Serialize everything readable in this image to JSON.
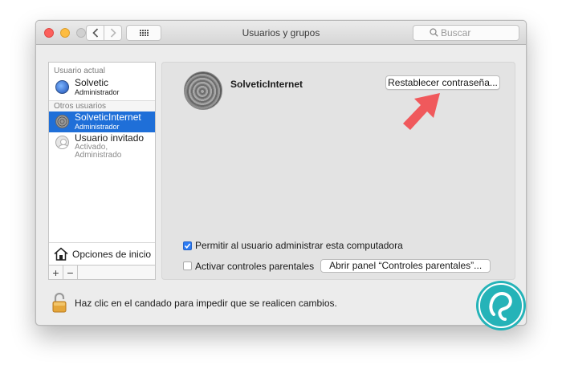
{
  "window": {
    "title": "Usuarios y grupos",
    "search_placeholder": "Buscar"
  },
  "sidebar": {
    "current_header": "Usuario actual",
    "other_header": "Otros usuarios",
    "users": [
      {
        "name": "Solvetic",
        "role": "Administrador",
        "icon": "globe-avatar"
      },
      {
        "name": "SolveticInternet",
        "role": "Administrador",
        "icon": "swirl-avatar",
        "selected": true
      },
      {
        "name": "Usuario invitado",
        "role": "Activado, Administrado",
        "icon": "guest-avatar"
      }
    ],
    "login_options": "Opciones de inicio",
    "add_label": "+",
    "remove_label": "−"
  },
  "content": {
    "username": "SolveticInternet",
    "reset_button": "Restablecer contraseña...",
    "admin_checkbox": {
      "label": "Permitir al usuario administrar esta computadora",
      "checked": true
    },
    "parental_checkbox": {
      "label": "Activar controles parentales",
      "checked": false
    },
    "parental_button": "Abrir panel “Controles parentales”..."
  },
  "lock_text": "Haz clic en el candado para impedir que se realicen cambios.",
  "colors": {
    "selection": "#1f6fd8",
    "arrow": "#f0595c",
    "checkbox_on": "#2d7cf4",
    "logo": "#25b3b8"
  }
}
